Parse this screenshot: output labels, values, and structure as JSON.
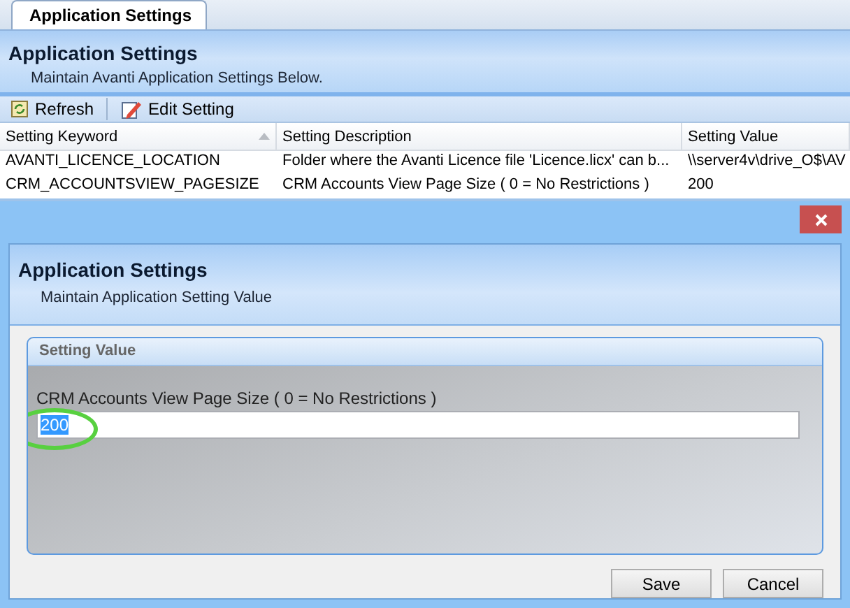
{
  "tabs": [
    {
      "label": "Application Settings",
      "selected": true
    }
  ],
  "header": {
    "title": "Application Settings",
    "subtitle": "Maintain Avanti Application Settings Below."
  },
  "toolbar": {
    "buttons": [
      {
        "label": "Refresh",
        "kind": "refresh"
      },
      {
        "label": "Edit Setting",
        "kind": "edit"
      }
    ]
  },
  "table": {
    "columns": [
      {
        "label": "Setting Keyword",
        "sorted": true
      },
      {
        "label": "Setting Description",
        "sorted": false
      },
      {
        "label": "Setting Value",
        "sorted": false
      }
    ],
    "rows": [
      [
        "AVANTI_LICENCE_LOCATION",
        "Folder where the Avanti Licence file 'Licence.licx' can b...",
        "\\\\server4v\\drive_O$\\AV"
      ],
      [
        "CRM_ACCOUNTSVIEW_PAGESIZE",
        "CRM Accounts View Page Size ( 0 = No Restrictions )",
        "200"
      ]
    ]
  },
  "dialog": {
    "title": "Application Settings",
    "subtitle": "Maintain Application Setting Value",
    "group_title": "Setting Value",
    "field_label": "CRM Accounts View Page Size ( 0 = No Restrictions )",
    "field_value": "200",
    "value_selected": true,
    "highlighted": true,
    "buttons": [
      "Save",
      "Cancel"
    ]
  }
}
